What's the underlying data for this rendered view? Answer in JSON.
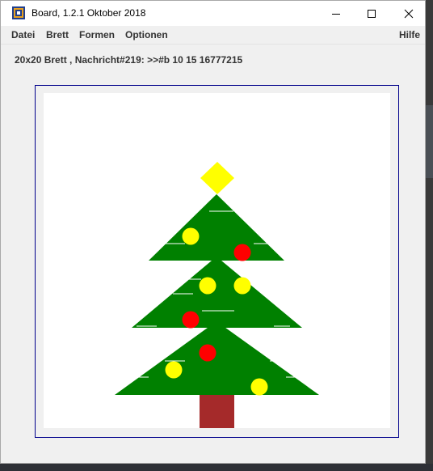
{
  "window": {
    "title": "Board, 1.2.1 Oktober 2018"
  },
  "menu": {
    "items": [
      "Datei",
      "Brett",
      "Formen",
      "Optionen"
    ],
    "help": "Hilfe"
  },
  "status": {
    "message": "20x20 Brett , Nachricht#219: >>#b 10 15 16777215"
  },
  "board": {
    "size": "20x20",
    "background_color": "#ffffff",
    "tree_color": "#008000",
    "trunk_color": "#a52a2a",
    "star_color": "#ffff00",
    "ornament_colors": {
      "yellow": "#ffff00",
      "red": "#ff0000"
    },
    "tinsel_color": "#ffffff"
  },
  "icons": {
    "app": "java-cup-icon",
    "minimize": "minimize-icon",
    "maximize": "maximize-icon",
    "close": "close-icon"
  }
}
